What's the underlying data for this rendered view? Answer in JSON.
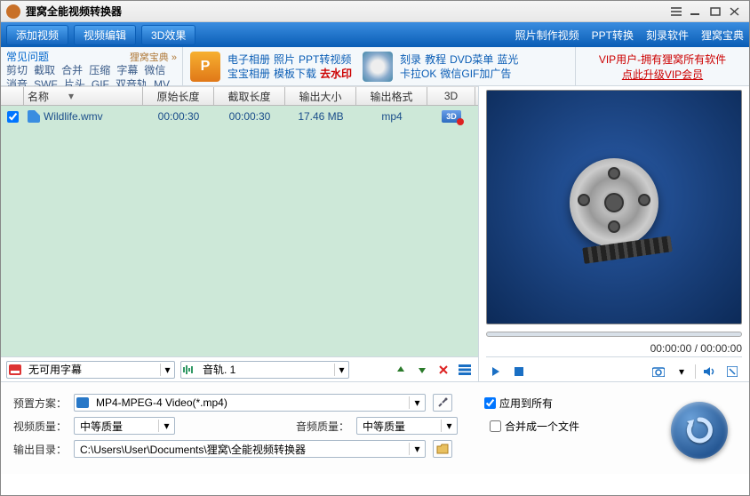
{
  "app": {
    "title": "狸窝全能视频转换器"
  },
  "toolbar": {
    "add": "添加视频",
    "edit": "视频编辑",
    "fx3d": "3D效果",
    "links": [
      "照片制作视频",
      "PPT转换",
      "刻录软件",
      "狸窝宝典"
    ]
  },
  "ribbon": {
    "faq_title": "常见问题",
    "faq_more": "狸窝宝典 »",
    "faq_items": [
      "剪切",
      "截取",
      "合并",
      "压缩",
      "字幕",
      "微信",
      "消音",
      "SWF",
      "片头",
      "GIF",
      "双音轨",
      "MV"
    ],
    "mid1": {
      "row1": [
        "电子相册",
        "照片",
        "PPT转视频"
      ],
      "row2": [
        "宝宝相册",
        "模板下载"
      ],
      "hot": "去水印"
    },
    "mid2": {
      "row1": [
        "刻录",
        "教程",
        "DVD菜单",
        "蓝光"
      ],
      "row2": [
        "卡拉OK",
        "微信GIF加广告"
      ]
    },
    "vip_line": "VIP用户-拥有狸窝所有软件",
    "vip_link": "点此升级VIP会员"
  },
  "grid": {
    "headers": {
      "name": "名称",
      "orig": "原始长度",
      "cut": "截取长度",
      "size": "输出大小",
      "fmt": "输出格式",
      "d3": "3D"
    },
    "rows": [
      {
        "checked": true,
        "name": "Wildlife.wmv",
        "orig": "00:00:30",
        "cut": "00:00:30",
        "size": "17.46 MB",
        "fmt": "mp4"
      }
    ]
  },
  "subbar": {
    "subtitle": "无可用字幕",
    "audio": "音轨. 1"
  },
  "player": {
    "time": "00:00:00 / 00:00:00"
  },
  "settings": {
    "preset_label": "预置方案：",
    "preset_value": "MP4-MPEG-4 Video(*.mp4)",
    "vq_label": "视频质量：",
    "vq_value": "中等质量",
    "aq_label": "音频质量：",
    "aq_value": "中等质量",
    "out_label": "输出目录：",
    "out_value": "C:\\Users\\User\\Documents\\狸窝\\全能视频转换器",
    "apply_all": "应用到所有",
    "merge": "合并成一个文件"
  }
}
